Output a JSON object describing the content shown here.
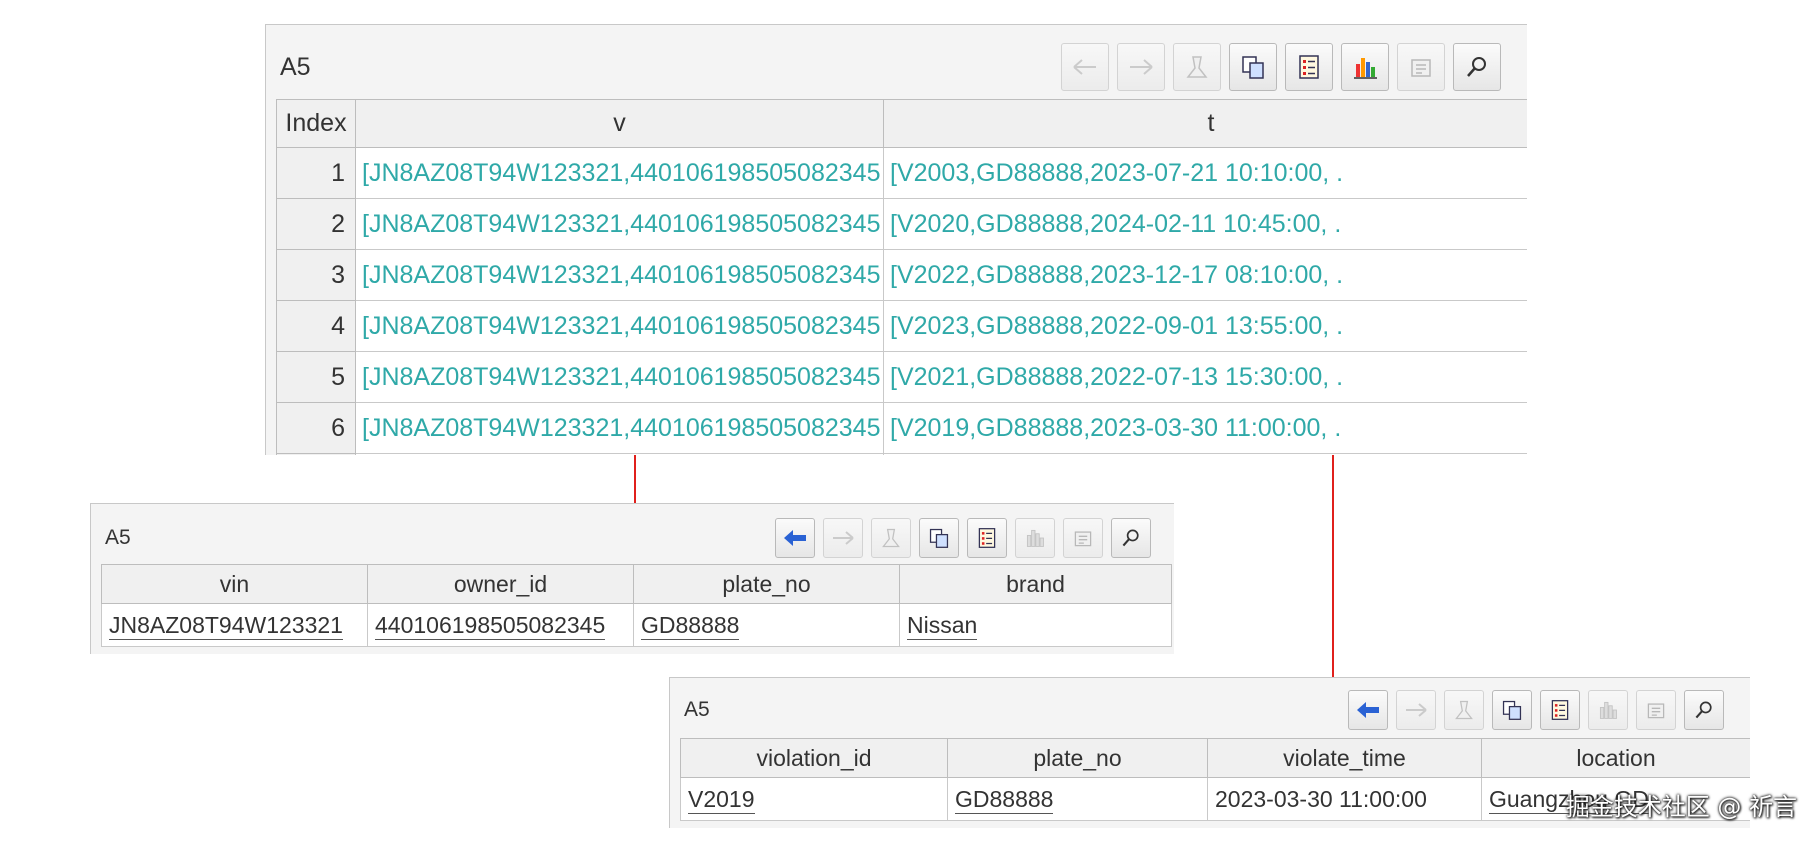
{
  "sequence_panel": {
    "title": "A5",
    "headers": [
      "Index",
      "v",
      "t"
    ],
    "rows": [
      {
        "index": "1",
        "v": "[JN8AZ08T94W123321,440106198505082345",
        "t": "[V2003,GD88888,2023-07-21 10:10:00, ."
      },
      {
        "index": "2",
        "v": "[JN8AZ08T94W123321,440106198505082345",
        "t": "[V2020,GD88888,2024-02-11 10:45:00, ."
      },
      {
        "index": "3",
        "v": "[JN8AZ08T94W123321,440106198505082345",
        "t": "[V2022,GD88888,2023-12-17 08:10:00, ."
      },
      {
        "index": "4",
        "v": "[JN8AZ08T94W123321,440106198505082345",
        "t": "[V2023,GD88888,2022-09-01 13:55:00, ."
      },
      {
        "index": "5",
        "v": "[JN8AZ08T94W123321,440106198505082345",
        "t": "[V2021,GD88888,2022-07-13 15:30:00, ."
      },
      {
        "index": "6",
        "v": "[JN8AZ08T94W123321,440106198505082345",
        "t": "[V2019,GD88888,2023-03-30 11:00:00, ."
      }
    ]
  },
  "vehicle_panel": {
    "title": "A5",
    "headers": [
      "vin",
      "owner_id",
      "plate_no",
      "brand"
    ],
    "row": {
      "vin": "JN8AZ08T94W123321",
      "owner_id": "440106198505082345",
      "plate_no": "GD88888",
      "brand": "Nissan"
    }
  },
  "violation_panel": {
    "title": "A5",
    "headers": [
      "violation_id",
      "plate_no",
      "violate_time",
      "location"
    ],
    "row": {
      "violation_id": "V2019",
      "plate_no": "GD88888",
      "violate_time": "2023-03-30 11:00:00",
      "location": "Guangzhou GD"
    }
  },
  "toolbar_icons": [
    "back-arrow-icon",
    "forward-arrow-icon",
    "clear-icon",
    "copy-icon",
    "list-icon",
    "chart-icon",
    "properties-icon",
    "search-icon"
  ],
  "watermark": "掘金技术社区 @ 祈言",
  "colors": {
    "cell_text": "#2fa9a8",
    "connector": "#e0201c",
    "panel_bg": "#f4f4f4",
    "header_bg": "#f0f0f0"
  }
}
